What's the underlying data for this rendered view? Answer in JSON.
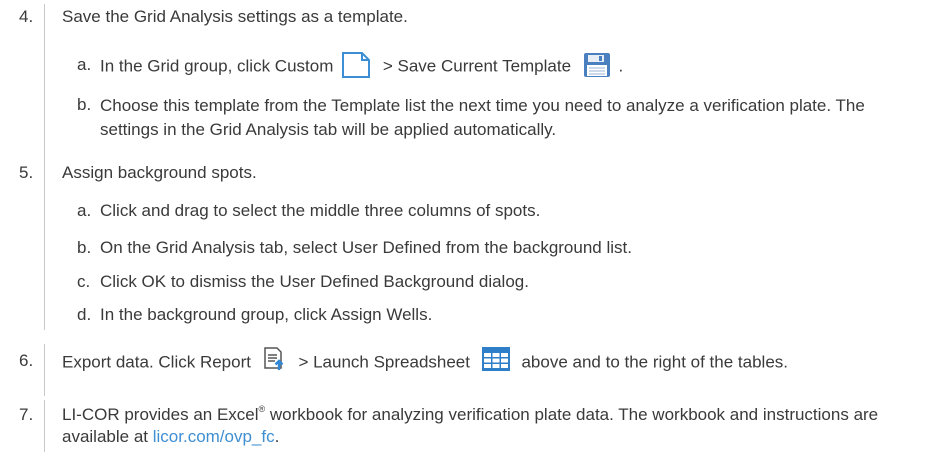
{
  "steps": [
    {
      "number": "4.",
      "text": "Save the Grid Analysis settings as a template.",
      "substeps": [
        {
          "letter": "a.",
          "text_before_icon1": "In the Grid group, click Custom",
          "icon1": "blank-page-icon",
          "text_between": "> Save Current Template",
          "icon2": "save-disk-icon",
          "text_after": "."
        },
        {
          "letter": "b.",
          "text": "Choose this template from the Template list the next time you need to analyze a verification plate. The settings in the Grid Analysis tab will be applied automatically."
        }
      ]
    },
    {
      "number": "5.",
      "text": "Assign background spots.",
      "substeps": [
        {
          "letter": "a.",
          "text": "Click and drag to select the middle three columns of spots."
        },
        {
          "letter": "b.",
          "text": "On the Grid Analysis tab, select User Defined from the background list."
        },
        {
          "letter": "c.",
          "text": "Click OK to dismiss the User Defined Background dialog."
        },
        {
          "letter": "d.",
          "text": "In the background group, click Assign Wells."
        }
      ]
    },
    {
      "number": "6.",
      "text_before_icon1": "Export data. Click Report",
      "icon1": "report-export-icon",
      "text_between": "> Launch Spreadsheet",
      "icon2": "spreadsheet-icon",
      "text_after": "above and to the right of the tables."
    },
    {
      "number": "7.",
      "text_before_sup": "LI-COR provides an Excel",
      "sup": "®",
      "text_after_sup": " workbook for analyzing verification plate data. The workbook and instructions are available at ",
      "link": "licor.com/ovp_fc",
      "text_end": "."
    }
  ],
  "colors": {
    "text": "#3a3a3a",
    "rule": "#c8c8c8",
    "link": "#3f8fd2",
    "icon_blue": "#3c8fd4"
  }
}
